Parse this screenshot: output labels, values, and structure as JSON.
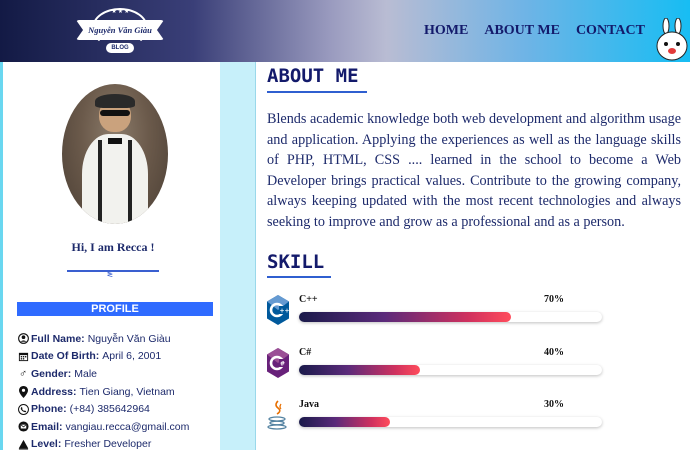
{
  "header": {
    "logo_text": "Nguyễn Văn Giàu",
    "logo_sub": "BLOG",
    "nav": [
      {
        "label": "HOME"
      },
      {
        "label": "ABOUT ME"
      },
      {
        "label": "CONTACT"
      }
    ]
  },
  "sidebar": {
    "greeting": "Hi, I am Recca !",
    "profile_heading": "PROFILE",
    "info": [
      {
        "icon": "user-circle-icon",
        "label": "Full Name:",
        "value": "Nguyễn Văn Giàu"
      },
      {
        "icon": "calendar-icon",
        "label": "Date Of Birth:",
        "value": "April 6, 2001"
      },
      {
        "icon": "male-icon",
        "label": "Gender:",
        "value": "Male"
      },
      {
        "icon": "map-pin-icon",
        "label": "Address:",
        "value": "Tien Giang, Vietnam"
      },
      {
        "icon": "phone-icon",
        "label": "Phone:",
        "value": "(+84) 385642964"
      },
      {
        "icon": "email-icon",
        "label": "Email:",
        "value": "vangiau.recca@gmail.com"
      },
      {
        "icon": "level-icon",
        "label": "Level:",
        "value": "Fresher Developer"
      }
    ]
  },
  "main": {
    "about_title": "ABOUT ME",
    "about_text": "Blends academic knowledge both web development and algorithm usage and application. Applying the experiences as well as the language skills of PHP, HTML, CSS .... learned in the school to become a Web Developer brings practical values. Contribute to the growing company, always keeping updated with the most recent technologies and always seeking to improve and grow as a professional and as a person.",
    "skill_title": "SKILL",
    "skills": [
      {
        "name": "C++",
        "percent_label": "70%",
        "level": 0.7,
        "icon": "cpp-logo-icon"
      },
      {
        "name": "C#",
        "percent_label": "40%",
        "level": 0.4,
        "icon": "csharp-logo-icon"
      },
      {
        "name": "Java",
        "percent_label": "30%",
        "level": 0.3,
        "icon": "java-logo-icon"
      }
    ]
  },
  "colors": {
    "accent_blue": "#2f6bff",
    "text_navy": "#1d2a6b",
    "sidebar_stripe": "#c7f0fa"
  }
}
